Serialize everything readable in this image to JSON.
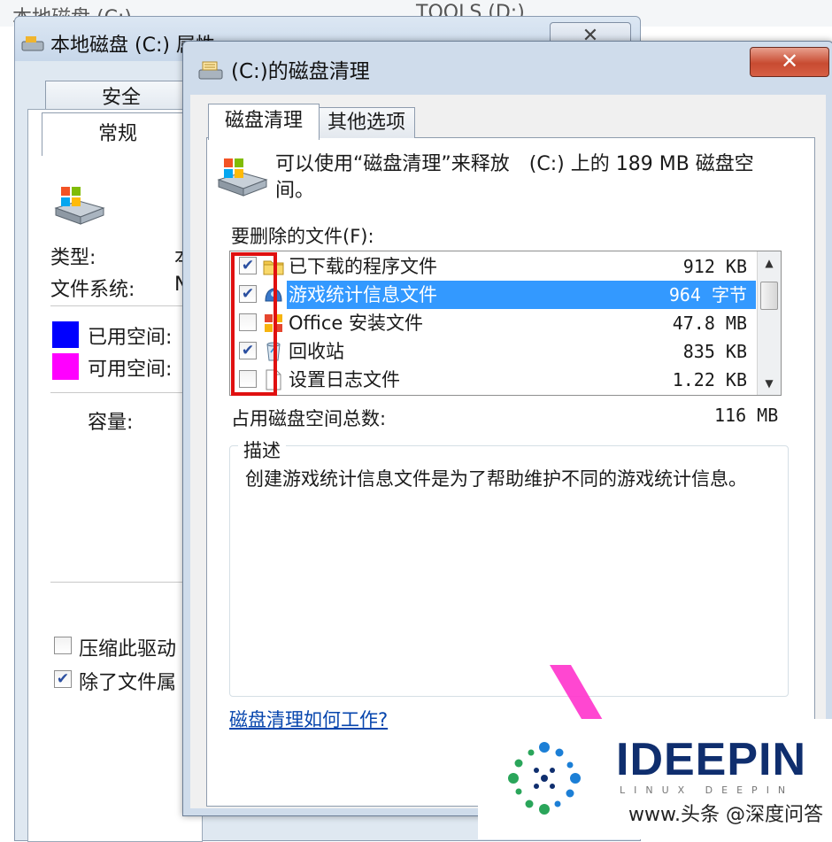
{
  "background": {
    "left_text": "本地磁盘 (C:)",
    "right_text": "TOOLS (D:)"
  },
  "properties_window": {
    "title": "本地磁盘 (C:) 属性",
    "close_glyph": "✕",
    "tabs": [
      {
        "label": "安全"
      },
      {
        "label": "常规"
      }
    ],
    "type_label": "类型:",
    "type_value": "本",
    "filesystem_label": "文件系统:",
    "filesystem_value": "N",
    "used_space_label": "已用空间:",
    "free_space_label": "可用空间:",
    "capacity_label": "容量:",
    "compress_label": "压缩此驱动",
    "index_label": "除了文件属",
    "compress_checked": false,
    "index_checked": true,
    "used_color": "#0000ff",
    "free_color": "#ff00ff"
  },
  "cleanup_dialog": {
    "title": "(C:)的磁盘清理",
    "close_glyph": "✕",
    "tabs": [
      {
        "label": "磁盘清理",
        "active": true
      },
      {
        "label": "其他选项",
        "active": false
      }
    ],
    "intro": "可以使用“磁盘清理”来释放　(C:) 上的 189 MB 磁盘空间。",
    "files_label": "要删除的文件(F):",
    "files": [
      {
        "name": "已下载的程序文件",
        "size": "912 KB",
        "checked": true,
        "selected": false,
        "icon": "folder-icon"
      },
      {
        "name": "游戏统计信息文件",
        "size": "964 字节",
        "checked": true,
        "selected": true,
        "icon": "game-stats-icon"
      },
      {
        "name": "Office 安装文件",
        "size": "47.8 MB",
        "checked": false,
        "selected": false,
        "icon": "office-icon"
      },
      {
        "name": "回收站",
        "size": "835 KB",
        "checked": true,
        "selected": false,
        "icon": "recycle-bin-icon"
      },
      {
        "name": "设置日志文件",
        "size": "1.22 KB",
        "checked": false,
        "selected": false,
        "icon": "document-icon"
      }
    ],
    "total_label": "占用磁盘空间总数:",
    "total_value": "116 MB",
    "description_title": "描述",
    "description": "创建游戏统计信息文件是为了帮助维护不同的游戏统计信息。",
    "help_link": "磁盘清理如何工作?"
  },
  "watermark": {
    "brand": "IDEEPIN",
    "sub": "LINUX DEEPIN",
    "caption": "www.头条 @深度问答"
  },
  "colors": {
    "highlight_border": "#e01010",
    "selection": "#3399ff",
    "arrow": "#ff33cc",
    "link": "#0645ad"
  }
}
